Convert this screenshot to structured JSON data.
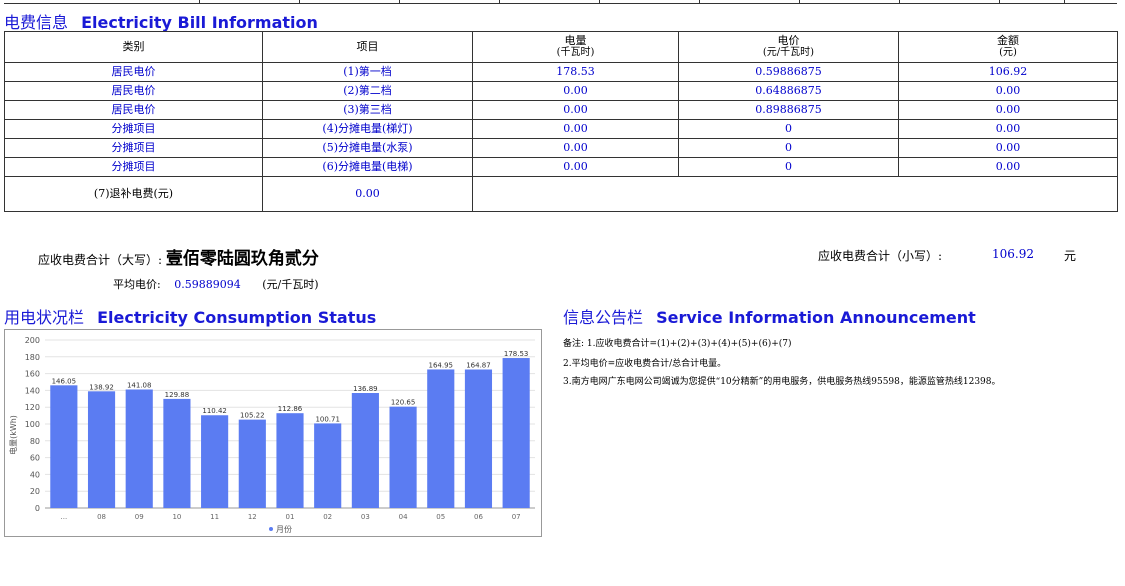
{
  "bill_section": {
    "title_cn": "电费信息",
    "title_en": "Electricity Bill Information",
    "headers": [
      "类别",
      "项目",
      "电量",
      "(千瓦时)",
      "电价",
      "(元/千瓦时)",
      "金额",
      "(元)"
    ],
    "rows": [
      {
        "category": "居民电价",
        "item": "(1)第一档",
        "kwh": "178.53",
        "price": "0.59886875",
        "amount": "106.92"
      },
      {
        "category": "居民电价",
        "item": "(2)第二档",
        "kwh": "0.00",
        "price": "0.64886875",
        "amount": "0.00"
      },
      {
        "category": "居民电价",
        "item": "(3)第三档",
        "kwh": "0.00",
        "price": "0.89886875",
        "amount": "0.00"
      },
      {
        "category": "分摊项目",
        "item": "(4)分摊电量(梯灯)",
        "kwh": "0.00",
        "price": "0",
        "amount": "0.00"
      },
      {
        "category": "分摊项目",
        "item": "(5)分摊电量(水泵)",
        "kwh": "0.00",
        "price": "0",
        "amount": "0.00"
      },
      {
        "category": "分摊项目",
        "item": "(6)分摊电量(电梯)",
        "kwh": "0.00",
        "price": "0",
        "amount": "0.00"
      }
    ],
    "refund_label": "(7)退补电费(元)",
    "refund_value": "0.00"
  },
  "totals": {
    "upper_label": "应收电费合计（大写）:",
    "upper_value": "壹佰零陆圆玖角贰分",
    "lower_label": "应收电费合计（小写）:",
    "lower_value": "106.92",
    "lower_unit": "元",
    "avg_label": "平均电价:",
    "avg_value": "0.59889094",
    "avg_unit": "(元/千瓦时)"
  },
  "usage_section": {
    "title_cn": "用电状况栏",
    "title_en": "Electricity Consumption Status"
  },
  "chart_data": {
    "type": "bar",
    "categories": [
      "...",
      "08",
      "09",
      "10",
      "11",
      "12",
      "01",
      "02",
      "03",
      "04",
      "05",
      "06",
      "07"
    ],
    "values": [
      146.05,
      138.92,
      141.08,
      129.88,
      110.42,
      105.22,
      112.86,
      100.71,
      136.89,
      120.65,
      164.95,
      164.87,
      178.53
    ],
    "value_labels": [
      "146.05",
      "138.92",
      "141.08",
      "129.88",
      "110.42",
      "105.22",
      "112.86",
      "100.71",
      "136.89",
      "120.65",
      "164.95",
      "164.87",
      "178.53"
    ],
    "ylabel": "电量(kWh)",
    "legend": "月份",
    "legend_position": "bottom",
    "ylim": [
      0,
      200
    ],
    "yticks": [
      "0",
      "20",
      "40",
      "60",
      "80",
      "100",
      "120",
      "140",
      "160",
      "180",
      "200"
    ],
    "bar_color": "#5b7cf2",
    "grid": true
  },
  "notice_section": {
    "title_cn": "信息公告栏",
    "title_en": "Service Information Announcement",
    "lines": [
      "备注: 1.应收电费合计=(1)+(2)+(3)+(4)+(5)+(6)+(7)",
      "2.平均电价=应收电费合计/总合计电量。",
      "3.南方电网广东电网公司竭诚为您提供“10分精新”的用电服务，供电服务热线95598，能源监管热线12398。"
    ]
  }
}
